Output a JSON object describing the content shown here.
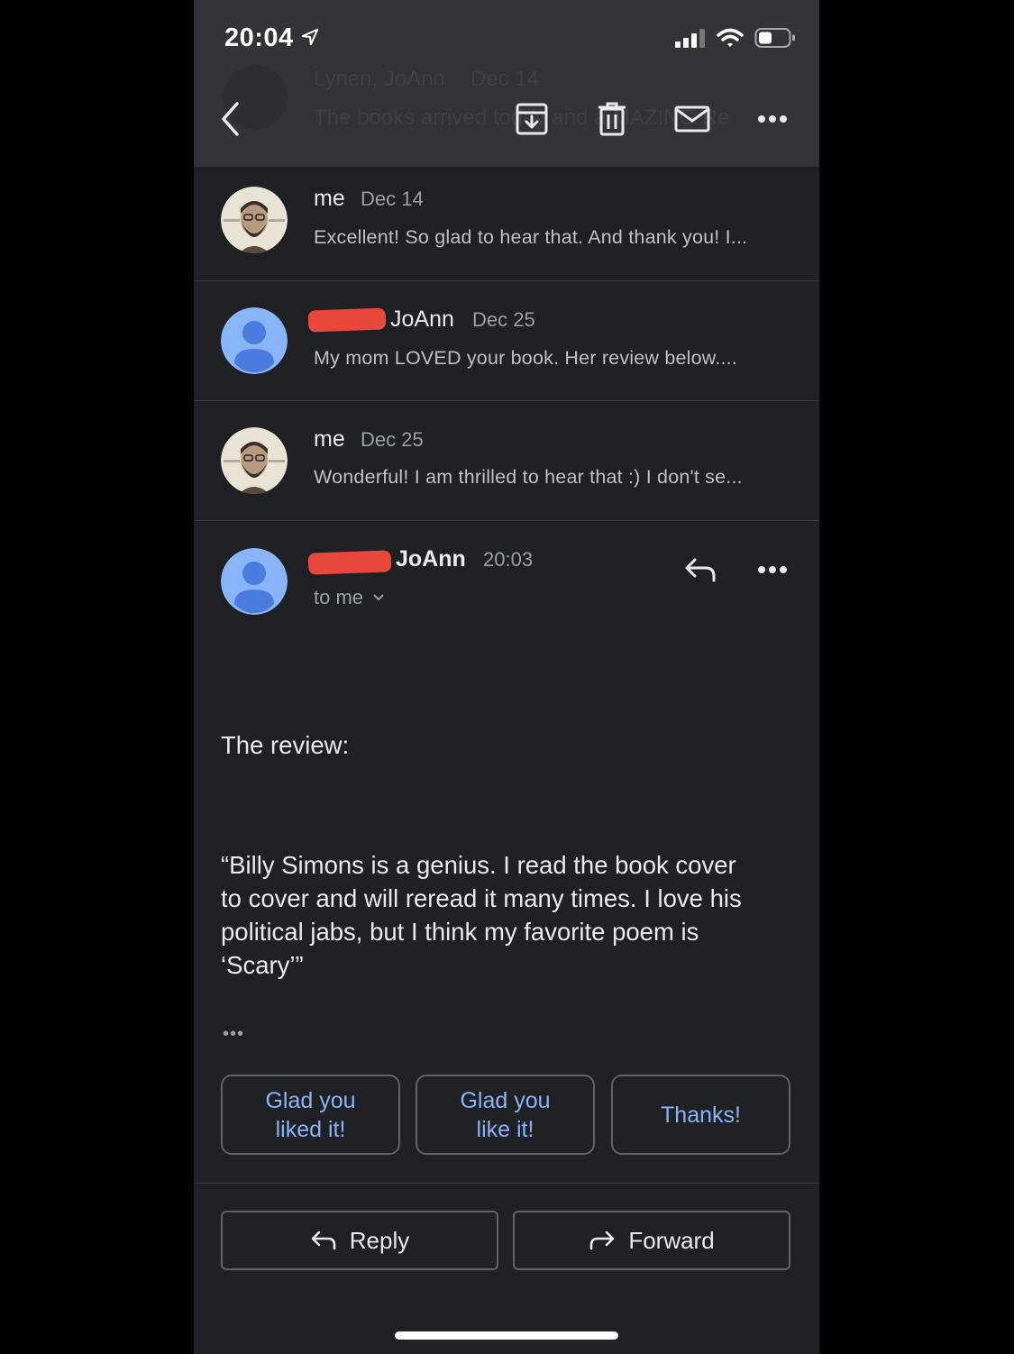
{
  "status_bar": {
    "time": "20:04"
  },
  "toolbar": {
    "ghost_sender": "Lynen, JoAnn",
    "ghost_date": "Dec 14",
    "ghost_subject": "The books arrived today and a MAZING Re"
  },
  "thread": [
    {
      "sender": "me",
      "date": "Dec 14",
      "snippet": "Excellent! So glad to hear that. And thank you! I..."
    },
    {
      "sender": "JoAnn",
      "date": "Dec 25",
      "snippet": "My mom LOVED your book. Her review below...."
    },
    {
      "sender": "me",
      "date": "Dec 25",
      "snippet": "Wonderful! I am thrilled to hear that :) I don't se..."
    }
  ],
  "open_message": {
    "sender": "JoAnn",
    "time": "20:03",
    "to": "to me",
    "body_intro": "The review:",
    "body_lines": [
      "“Billy Simons is a genius.  I read the book cover",
      "to cover and will reread it many times.  I love his",
      "political jabs, but I think my favorite poem is",
      "‘Scary’”"
    ],
    "more_dots": "•••"
  },
  "smart_replies": [
    {
      "line1": "Glad you",
      "line2": "liked it!"
    },
    {
      "line1": "Glad you",
      "line2": "like it!"
    },
    {
      "line1": "Thanks!",
      "line2": ""
    }
  ],
  "actions": {
    "reply": "Reply",
    "forward": "Forward"
  },
  "colors": {
    "background": "#202124",
    "accent": "#8ab4f8",
    "redaction": "#e8473c",
    "avatar_blue": "#8ab4f8"
  }
}
